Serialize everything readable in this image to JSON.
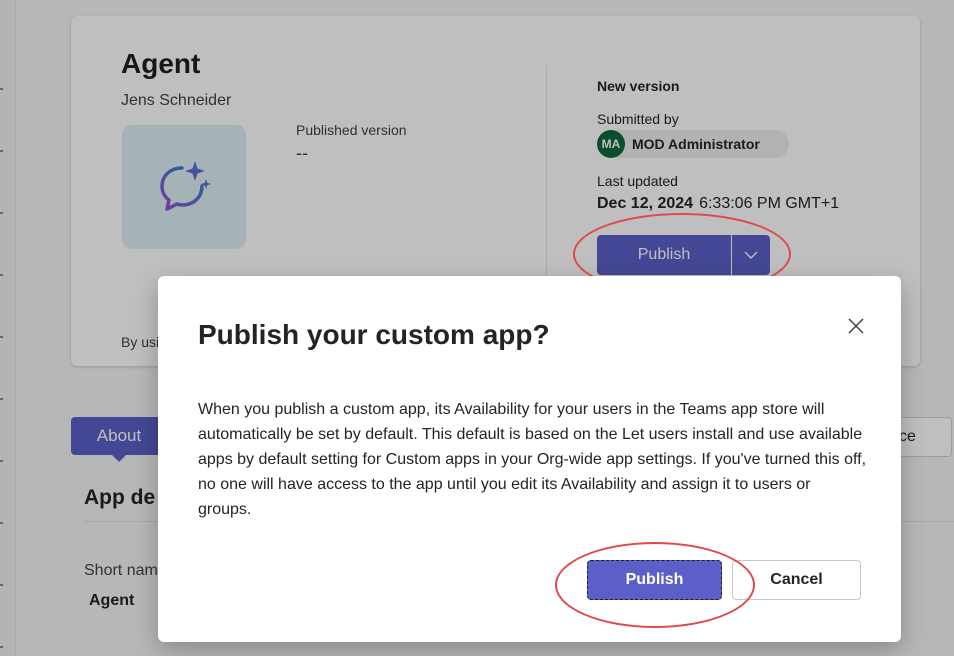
{
  "app": {
    "title": "Agent",
    "author": "Jens Schneider",
    "icon": "chat-sparkle-icon",
    "published_version_label": "Published version",
    "published_version_value": "--",
    "by_using_text": "By usi"
  },
  "new_version": {
    "heading": "New version",
    "submitted_by_label": "Submitted by",
    "submitter_initials": "MA",
    "submitter_name": "MOD Administrator",
    "last_updated_label": "Last updated",
    "last_updated_date": "Dec 12, 2024",
    "last_updated_time": "6:33:06 PM GMT+1",
    "publish_label": "Publish"
  },
  "tabs": {
    "about": "About",
    "right_partial": "ce"
  },
  "details": {
    "section_title": "App de",
    "short_name_label": "Short nam",
    "short_name_value": "Agent"
  },
  "dialog": {
    "title": "Publish your custom app?",
    "body": "When you publish a custom app, its Availability for your users in the Teams app store will automatically be set by default. This default is based on the Let users install and use available apps by default setting for Custom apps in your Org-wide app settings. If you've turned this off, no one will have access to the app until you edit its Availability and assign it to users or groups.",
    "publish_label": "Publish",
    "cancel_label": "Cancel"
  },
  "colors": {
    "accent": "#5b5fc7",
    "avatar_bg": "#0e6a3b",
    "annotation": "#e0494a",
    "icon_bg": "#ddeff3"
  }
}
